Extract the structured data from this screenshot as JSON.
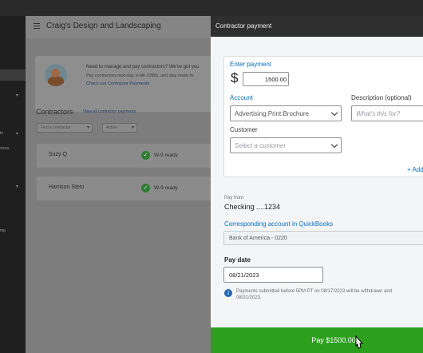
{
  "company_name": "Craig's Design and Landscaping",
  "left_nav": {
    "fragments": [
      "ts",
      "vices",
      "mp"
    ]
  },
  "promo": {
    "headline": "Need to manage and pay contractors? We've got you",
    "body": "Pay contractors next-day, e-file 1099s, and stay ready fo",
    "link": "Check out Contractor Payments"
  },
  "contractors": {
    "title": "Contractors",
    "view_all": "View all contractor payments",
    "find_placeholder": "Find a contractor",
    "filter_value": "Active",
    "rows": [
      {
        "name": "Suzy Q",
        "status": "W-9 ready"
      },
      {
        "name": "Harrison Stein",
        "status": "W-9 ready"
      }
    ]
  },
  "panel": {
    "title": "Contractor payment",
    "enter_payment_label": "Enter payment",
    "currency_symbol": "$",
    "amount": "1500.00",
    "account_label": "Account",
    "account_value": "Advertising:Print:Brochure",
    "description_label": "Description (optional)",
    "description_placeholder": "What's this for?",
    "customer_label": "Customer",
    "customer_placeholder": "Select a customer",
    "add_link": "+ Add",
    "pay_from_label": "Pay from",
    "pay_from_value": "Checking ....1234",
    "corresponding_label": "Corresponding account in QuickBooks",
    "corresponding_value": "Bank of America - 0220",
    "pay_date_label": "Pay date",
    "pay_date_value": "08/21/2023",
    "note_line1": "Payments submitted before 5PM PT on 08/17/2023 will be withdrawn and",
    "note_line2": "08/21/2023.",
    "pay_button": "Pay $1500.00"
  },
  "colors": {
    "primary_green": "#2ca01c",
    "link_blue": "#0a6ebd",
    "panel_header": "#2f2f2f"
  },
  "icons": {
    "menu": "hamburger-icon",
    "check": "check-circle-icon",
    "info": "info-icon",
    "dropdown": "chevron-down-icon"
  }
}
